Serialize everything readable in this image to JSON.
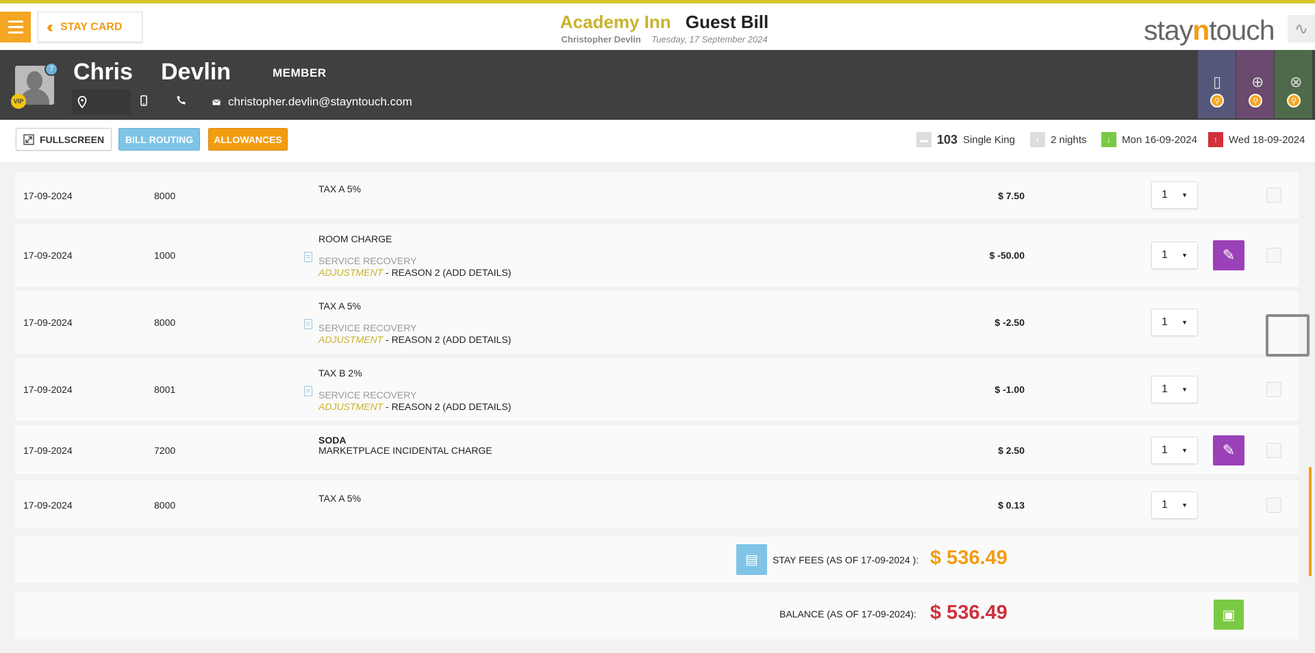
{
  "header": {
    "stay_card_label": "STAY CARD",
    "hotel_name": "Academy Inn",
    "page_title": "Guest Bill",
    "guest_name": "Christopher Devlin",
    "date": "Tuesday, 17 September 2024",
    "brand_prefix": "stay",
    "brand_n": "n",
    "brand_suffix": "touch"
  },
  "guest": {
    "first_name": "Chris",
    "last_name": "Devlin",
    "member_label": "MEMBER",
    "notification_count": "7",
    "vip_label": "VIP",
    "email": "christopher.devlin@stayntouch.com"
  },
  "toolbar": {
    "fullscreen_label": "FULLSCREEN",
    "bill_routing_label": "BILL ROUTING",
    "allowances_label": "ALLOWANCES",
    "room_number": "103",
    "room_type": "Single King",
    "nights": "2 nights",
    "arrival": "Mon 16-09-2024",
    "departure": "Wed 18-09-2024"
  },
  "rows": [
    {
      "date": "17-09-2024",
      "code": "8000",
      "desc": "TAX A 5%",
      "amount": "$ 7.50",
      "qty": "1"
    },
    {
      "date": "17-09-2024",
      "code": "1000",
      "desc": "ROOM CHARGE",
      "sub": "SERVICE RECOVERY",
      "adj_label": "ADJUSTMENT",
      "adj_text": " - REASON 2 (ADD DETAILS)",
      "amount": "$ -50.00",
      "qty": "1"
    },
    {
      "date": "17-09-2024",
      "code": "8000",
      "desc": "TAX A 5%",
      "sub": "SERVICE RECOVERY",
      "adj_label": "ADJUSTMENT",
      "adj_text": " - REASON 2 (ADD DETAILS)",
      "amount": "$ -2.50",
      "qty": "1"
    },
    {
      "date": "17-09-2024",
      "code": "8001",
      "desc": "TAX B 2%",
      "sub": "SERVICE RECOVERY",
      "adj_label": "ADJUSTMENT",
      "adj_text": " - REASON 2 (ADD DETAILS)",
      "amount": "$ -1.00",
      "qty": "1"
    },
    {
      "date": "17-09-2024",
      "code": "7200",
      "desc": "SODA",
      "sub": "MARKETPLACE INCIDENTAL CHARGE",
      "amount": "$ 2.50",
      "qty": "1"
    },
    {
      "date": "17-09-2024",
      "code": "8000",
      "desc": "TAX A 5%",
      "amount": "$ 0.13",
      "qty": "1"
    }
  ],
  "summary": {
    "stay_fees_label": "STAY FEES (AS OF  17-09-2024 ):",
    "stay_fees_value": "$ 536.49",
    "balance_label": "BALANCE (AS OF  17-09-2024):",
    "balance_value": "$ 536.49"
  },
  "colors": {
    "accent_orange": "#f39c12",
    "hotel_gold": "#c9b22d",
    "balance_red": "#d0313b",
    "edit_purple": "#9b41b8"
  }
}
